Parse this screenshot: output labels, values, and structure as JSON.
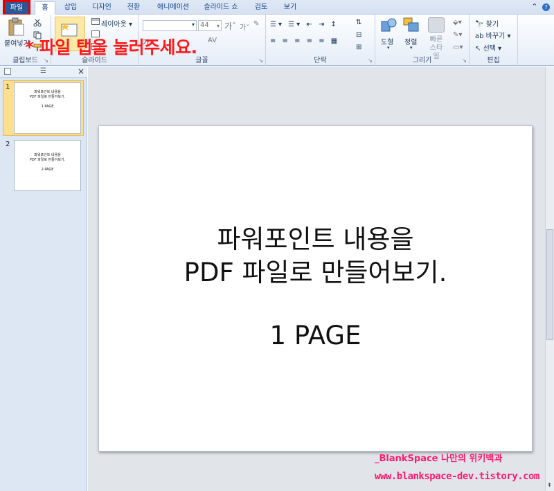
{
  "tabs": [
    {
      "label": "파일"
    },
    {
      "label": "홈"
    },
    {
      "label": "삽입"
    },
    {
      "label": "디자인"
    },
    {
      "label": "전환"
    },
    {
      "label": "애니메이션"
    },
    {
      "label": "슬라이드 쇼"
    },
    {
      "label": "검토"
    },
    {
      "label": "보기"
    }
  ],
  "ribbon": {
    "clipboard": {
      "label": "클립보드",
      "paste": "붙여넣기"
    },
    "slides": {
      "label": "슬라이드",
      "layout": "레이아웃",
      "new_slide": "새 슬라이드"
    },
    "font": {
      "label": "글꼴",
      "size": "44"
    },
    "paragraph": {
      "label": "단락"
    },
    "drawing": {
      "label": "그리기",
      "shapes": "도형",
      "arrange": "정렬",
      "quick_styles": "빠른 스타일"
    },
    "editing": {
      "label": "편집",
      "find": "찾기",
      "replace": "바꾸기",
      "select": "선택"
    }
  },
  "annotation": "* 파일 탭을 눌러주세요.",
  "slides": [
    {
      "number": "1",
      "line1": "파워포인트 내용을",
      "line2": "PDF 파일로 만들어보기.",
      "page": "1 PAGE"
    },
    {
      "number": "2",
      "line1": "파워포인트 내용을",
      "line2": "PDF 파일로 만들어보기.",
      "page": "2 PAGE"
    }
  ],
  "current_slide": {
    "line1": "파워포인트 내용을",
    "line2": "PDF 파일로 만들어보기.",
    "page": "1 PAGE"
  },
  "watermark": {
    "line1": "_BlankSpace 나만의 위키백과",
    "line2": "www.blankspace-dev.tistory.com"
  },
  "colors": {
    "file_tab": "#2b5797",
    "annotation": "#ff1a1a",
    "watermark": "#ff1a6e",
    "active_thumb": "#fce08f"
  }
}
